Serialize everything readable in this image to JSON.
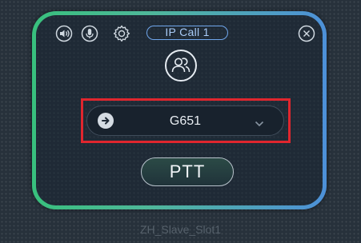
{
  "header": {
    "speaker_icon": "speaker-icon",
    "mic_icon": "microphone-icon",
    "settings_icon": "gear-icon",
    "call_label": "IP Call 1",
    "close_icon": "close-icon"
  },
  "contact": {
    "avatar_icon": "group-avatar-icon"
  },
  "channel_select": {
    "selected_value": "G651",
    "arrow_icon": "arrow-right-circle-icon",
    "dropdown_icon": "chevron-down-icon"
  },
  "ptt_button": {
    "label": "PTT"
  },
  "slot_name": "ZH_Slave_Slot1",
  "colors": {
    "frame_gradient_start": "#38c07d",
    "frame_gradient_end": "#4d90d8",
    "highlight_border": "#e0262e",
    "call_pill_border": "#6fa6ec"
  }
}
